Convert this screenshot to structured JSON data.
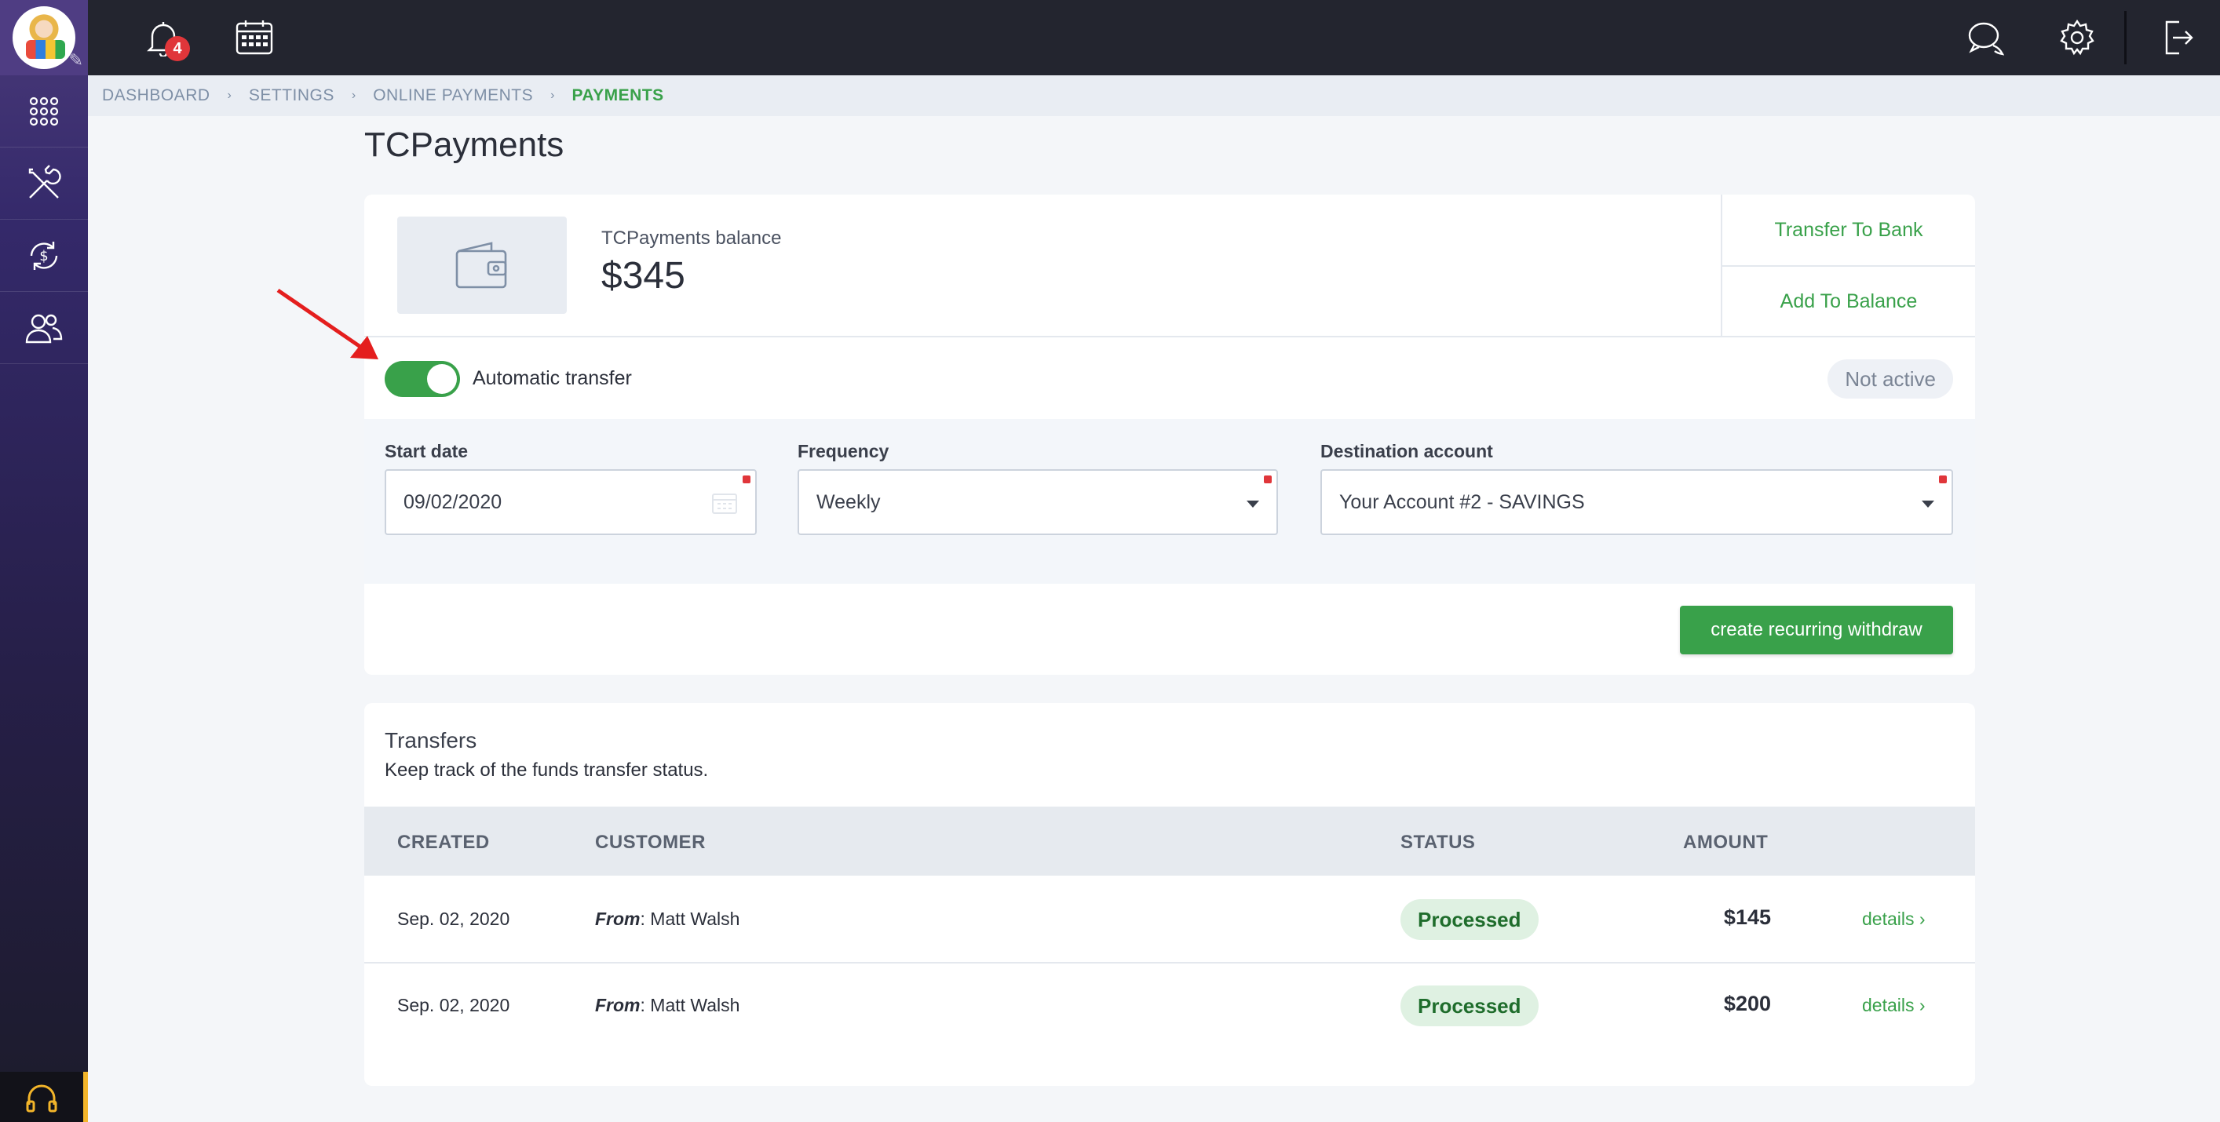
{
  "topbar": {
    "notification_count": "4"
  },
  "breadcrumb": {
    "items": [
      "DASHBOARD",
      "SETTINGS",
      "ONLINE PAYMENTS",
      "PAYMENTS"
    ],
    "separator": "›"
  },
  "page": {
    "title": "TCPayments"
  },
  "balance": {
    "label": "TCPayments balance",
    "value": "$345"
  },
  "actions": {
    "transfer_to_bank": "Transfer To Bank",
    "add_to_balance": "Add To Balance"
  },
  "auto_transfer": {
    "label": "Automatic transfer",
    "enabled": true,
    "status": "Not active"
  },
  "form": {
    "start_date": {
      "label": "Start date",
      "value": "09/02/2020"
    },
    "frequency": {
      "label": "Frequency",
      "value": "Weekly"
    },
    "destination": {
      "label": "Destination account",
      "value": "Your Account #2 - SAVINGS"
    },
    "create_button": "create recurring withdraw"
  },
  "transfers": {
    "title": "Transfers",
    "subtitle": "Keep track of the funds transfer status.",
    "columns": {
      "created": "CREATED",
      "customer": "CUSTOMER",
      "status": "STATUS",
      "amount": "AMOUNT"
    },
    "rows": [
      {
        "created": "Sep. 02, 2020",
        "from_label": "From",
        "customer": ": Matt Walsh",
        "status": "Processed",
        "amount": "$145",
        "details": "details"
      },
      {
        "created": "Sep. 02, 2020",
        "from_label": "From",
        "customer": ": Matt Walsh",
        "status": "Processed",
        "amount": "$200",
        "details": "details"
      }
    ]
  },
  "colors": {
    "accent": "#39a14a",
    "sidebar": "#34296a",
    "topbar": "#23252f",
    "badge": "#e0363a"
  },
  "icons": [
    "pin-icon",
    "apps-grid-icon",
    "tools-icon",
    "dollar-cycle-icon",
    "users-icon",
    "headset-icon",
    "bell-icon",
    "calendar-icon",
    "chat-icon",
    "gear-icon",
    "logout-icon",
    "wallet-icon",
    "chevron-right-icon"
  ]
}
